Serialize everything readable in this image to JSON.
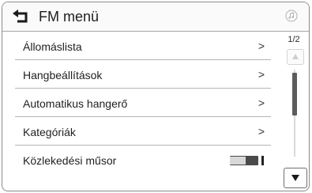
{
  "header": {
    "title": "FM menü",
    "back_icon": "back-arrow-icon",
    "status_icon": "music-note-icon"
  },
  "menu": {
    "items": [
      {
        "label": "Állomáslista",
        "trailing": ">"
      },
      {
        "label": "Hangbeállítások",
        "trailing": ">"
      },
      {
        "label": "Automatikus hangerő",
        "trailing": ">"
      },
      {
        "label": "Kategóriák",
        "trailing": ">"
      },
      {
        "label": "Közlekedési műsor",
        "trailing": "toggle"
      }
    ]
  },
  "scroll": {
    "page_indicator": "1/2",
    "up_icon": "scroll-up-arrow-icon",
    "down_icon": "scroll-down-arrow-icon"
  }
}
